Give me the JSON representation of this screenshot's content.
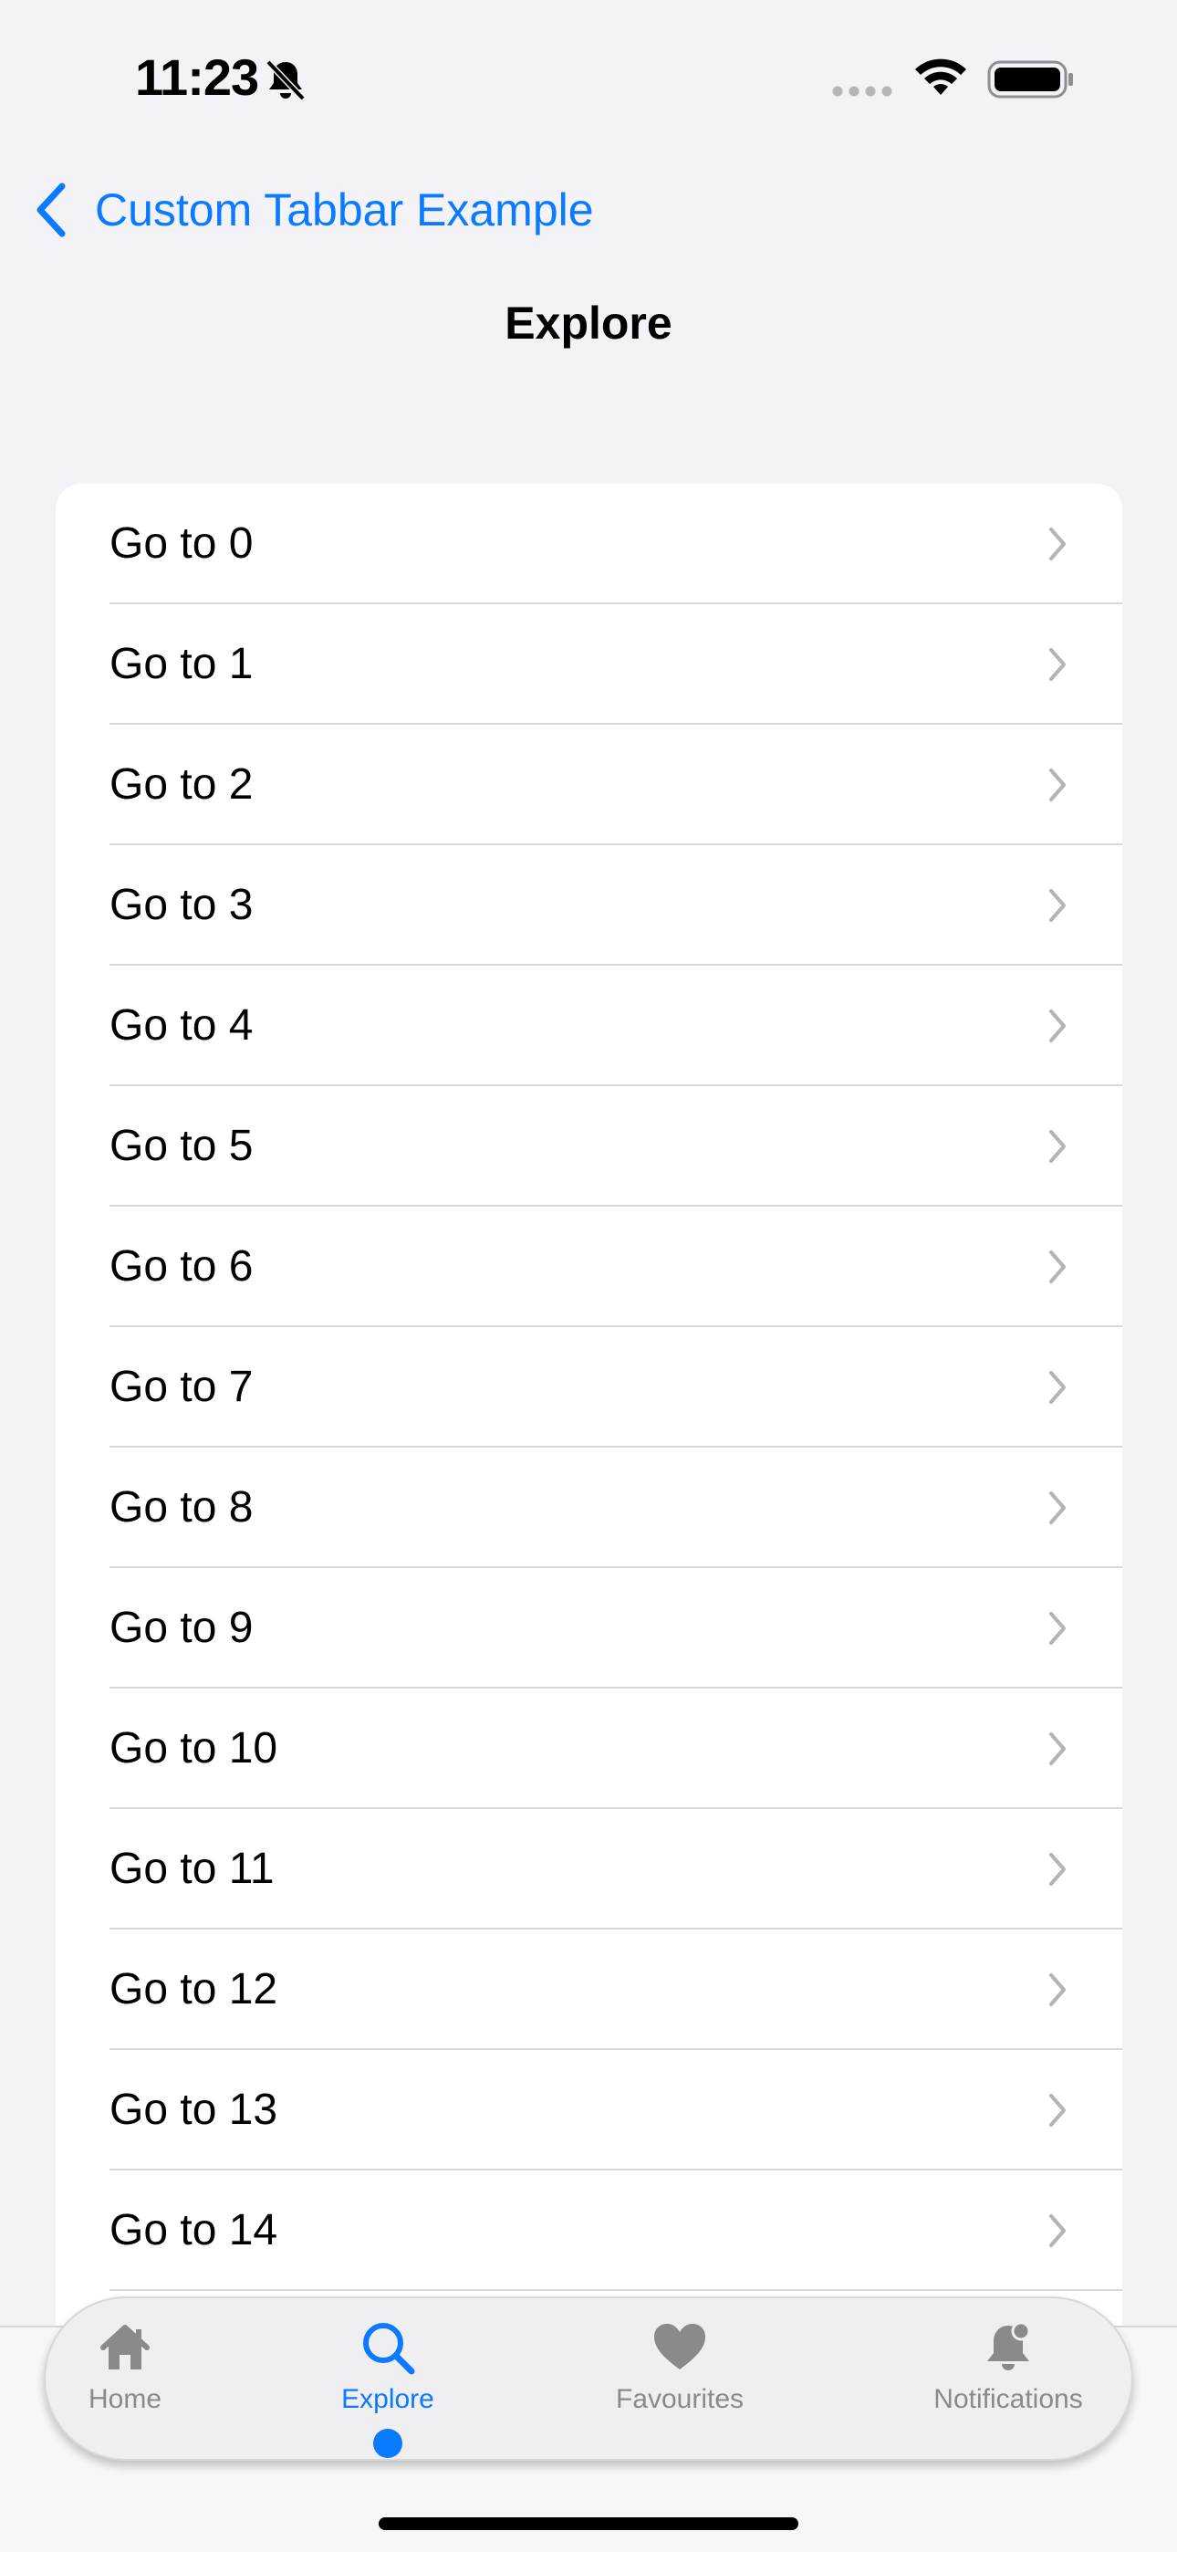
{
  "status_bar": {
    "time": "11:23",
    "silent_icon": "bell-slash-icon",
    "signal_icon": "cell-signal-icon",
    "wifi_icon": "wifi-icon",
    "battery_icon": "battery-icon"
  },
  "nav": {
    "back_label": "Custom Tabbar Example",
    "title": "Explore"
  },
  "list": {
    "items": [
      {
        "label": "Go to 0"
      },
      {
        "label": "Go to 1"
      },
      {
        "label": "Go to 2"
      },
      {
        "label": "Go to 3"
      },
      {
        "label": "Go to 4"
      },
      {
        "label": "Go to 5"
      },
      {
        "label": "Go to 6"
      },
      {
        "label": "Go to 7"
      },
      {
        "label": "Go to 8"
      },
      {
        "label": "Go to 9"
      },
      {
        "label": "Go to 10"
      },
      {
        "label": "Go to 11"
      },
      {
        "label": "Go to 12"
      },
      {
        "label": "Go to 13"
      },
      {
        "label": "Go to 14"
      }
    ]
  },
  "tabbar": {
    "tabs": [
      {
        "label": "Home",
        "icon": "house-icon",
        "active": false
      },
      {
        "label": "Explore",
        "icon": "magnifier-icon",
        "active": true
      },
      {
        "label": "Favourites",
        "icon": "heart-icon",
        "active": false
      },
      {
        "label": "Notifications",
        "icon": "bell-badge-icon",
        "active": false
      }
    ]
  },
  "colors": {
    "accent": "#0A7AFF",
    "background": "#F2F2F7",
    "inactive": "#8A8A8E"
  }
}
